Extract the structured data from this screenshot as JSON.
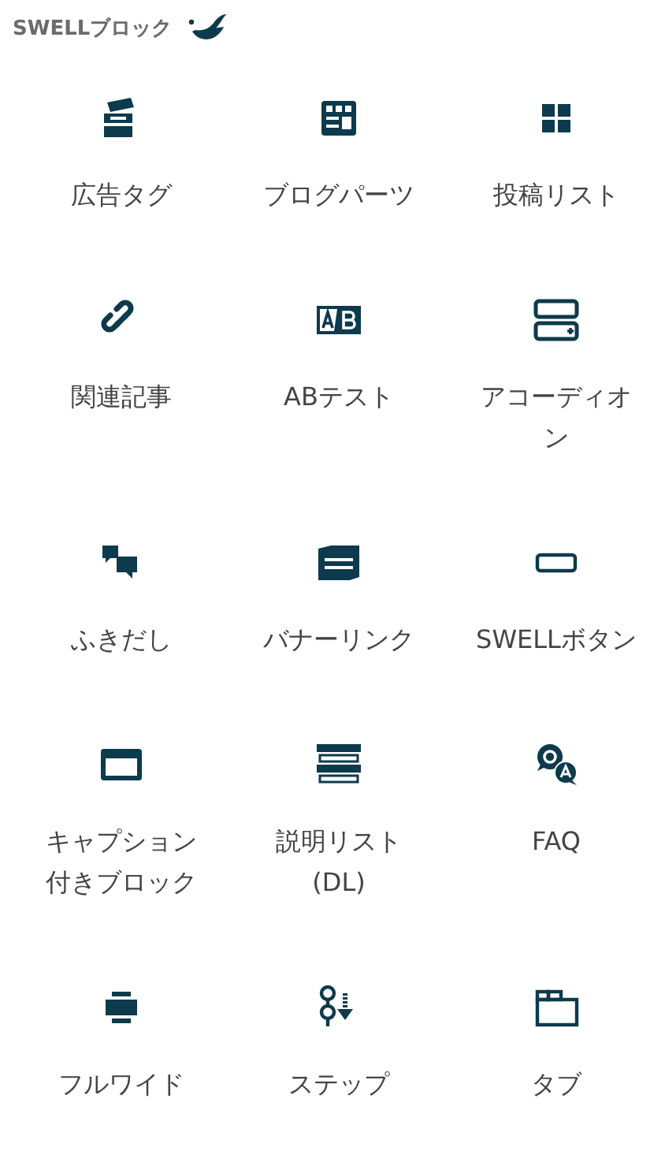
{
  "header": {
    "title": "SWELLブロック"
  },
  "blocks": [
    {
      "label": "広告タグ",
      "kind": "tickets"
    },
    {
      "label": "ブログパーツ",
      "kind": "layout"
    },
    {
      "label": "投稿リスト",
      "kind": "grid"
    },
    {
      "label": "関連記事",
      "kind": "link"
    },
    {
      "label": "ABテスト",
      "kind": "ab"
    },
    {
      "label": "アコーディオン",
      "kind": "accordion"
    },
    {
      "label": "ふきだし",
      "kind": "bubbles"
    },
    {
      "label": "バナーリンク",
      "kind": "banner"
    },
    {
      "label": "SWELLボタン",
      "kind": "button"
    },
    {
      "label": "キャプション付きブロック",
      "kind": "caption"
    },
    {
      "label": "説明リスト(DL)",
      "kind": "dl"
    },
    {
      "label": "FAQ",
      "kind": "faq"
    },
    {
      "label": "フルワイド",
      "kind": "fullwide"
    },
    {
      "label": "ステップ",
      "kind": "step"
    },
    {
      "label": "タブ",
      "kind": "tabs"
    }
  ]
}
